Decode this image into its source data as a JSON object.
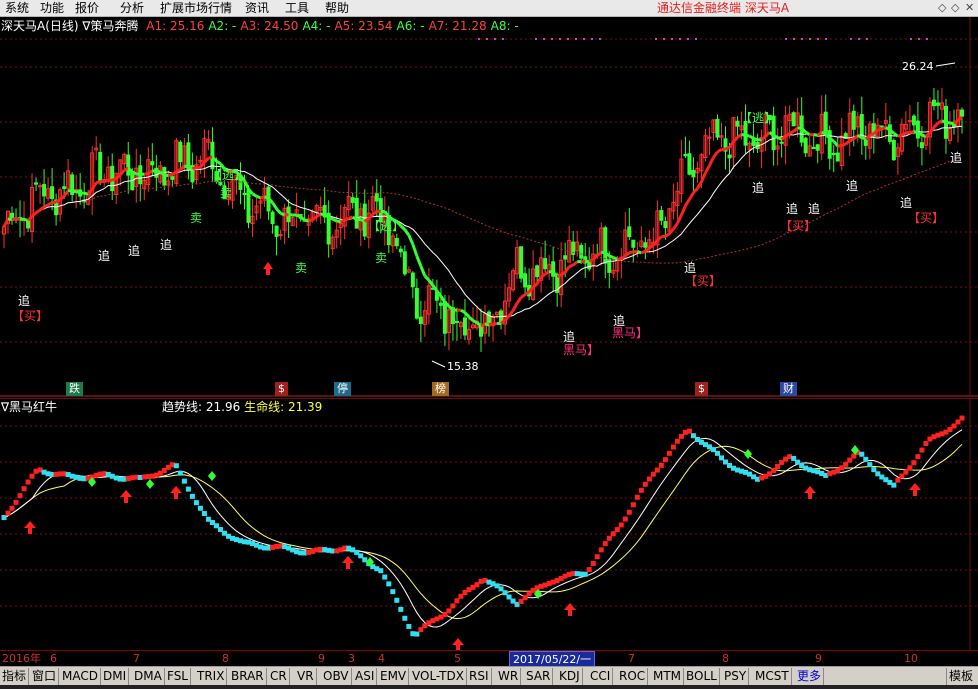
{
  "menu": [
    "系统",
    "功能",
    "报价",
    "分析",
    "扩展市场行情",
    "资讯",
    "工具",
    "帮助"
  ],
  "app_title": "通达信金融终端  深天马A",
  "window_controls": [
    "◇",
    "◇",
    "✕"
  ],
  "main_header": {
    "stock": "深天马A",
    "period": "(日线)",
    "indicator": "∇策马奔腾",
    "values": [
      {
        "label": "A1:",
        "value": "25.16",
        "color": "#ff4040"
      },
      {
        "label": "A2:",
        "value": "-",
        "color": "#40ff40"
      },
      {
        "label": "A3:",
        "value": "24.50",
        "color": "#ff4040"
      },
      {
        "label": "A4:",
        "value": "-",
        "color": "#40ff40"
      },
      {
        "label": "A5:",
        "value": "23.54",
        "color": "#ff4040"
      },
      {
        "label": "A6:",
        "value": "-",
        "color": "#40ff40"
      },
      {
        "label": "A7:",
        "value": "21.28",
        "color": "#ff4040"
      },
      {
        "label": "A8:",
        "value": "-",
        "color": "#40ff40"
      }
    ]
  },
  "indicator_header": {
    "name": "∇黑马红牛",
    "trend_label": "趋势线:",
    "trend_value": "21.96",
    "life_label": "生命线:",
    "life_value": "21.39"
  },
  "price_annotations": {
    "high": "26.24",
    "low": "15.38"
  },
  "signals": [
    {
      "text": "追",
      "color": "#ffffff"
    },
    {
      "text": "【买】",
      "color": "#ff3030"
    },
    {
      "text": "追",
      "color": "#ffffff"
    },
    {
      "text": "追",
      "color": "#ffffff"
    },
    {
      "text": "追",
      "color": "#ffffff"
    },
    {
      "text": "【逃】",
      "color": "#40ff40"
    },
    {
      "text": "卖",
      "color": "#40ff40"
    },
    {
      "text": "卖",
      "color": "#40ff40"
    },
    {
      "text": "卖",
      "color": "#40ff40"
    },
    {
      "text": "【逃】",
      "color": "#40ff40"
    },
    {
      "text": "卖",
      "color": "#40ff40"
    },
    {
      "text": "追",
      "color": "#ffffff"
    },
    {
      "text": "黑马】",
      "color": "#ff3080"
    },
    {
      "text": "追",
      "color": "#ffffff"
    },
    {
      "text": "黑马】",
      "color": "#ff3080"
    },
    {
      "text": "追",
      "color": "#ffffff"
    },
    {
      "text": "【买】",
      "color": "#ff3030"
    },
    {
      "text": "【逃】",
      "color": "#40ff40"
    },
    {
      "text": "追",
      "color": "#ffffff"
    },
    {
      "text": "追",
      "color": "#ffffff"
    },
    {
      "text": "追",
      "color": "#ffffff"
    },
    {
      "text": "【买】",
      "color": "#ff3030"
    },
    {
      "text": "追",
      "color": "#ffffff"
    },
    {
      "text": "追",
      "color": "#ffffff"
    },
    {
      "text": "【买】",
      "color": "#ff3030"
    },
    {
      "text": "追",
      "color": "#ffffff"
    }
  ],
  "event_badges": [
    {
      "text": "跌",
      "color": "#1f7a4a"
    },
    {
      "text": "$",
      "color": "#a02020"
    },
    {
      "text": "停",
      "color": "#1f6a8a"
    },
    {
      "text": "榜",
      "color": "#a06a20"
    },
    {
      "text": "$",
      "color": "#a02020"
    },
    {
      "text": "财",
      "color": "#2a4aa0"
    }
  ],
  "date_axis": {
    "ticks": [
      "2016年",
      "6",
      "7",
      "8",
      "9",
      "3",
      "4",
      "5",
      "7",
      "8",
      "9",
      "10"
    ],
    "cursor_date": "2017/05/22/一"
  },
  "tabs": [
    "指标",
    "窗口",
    "MACD",
    "DMI",
    "DMA",
    "FSL",
    "TRIX",
    "BRAR",
    "CR",
    "VR",
    "OBV",
    "ASI",
    "EMV",
    "VOL-TDX",
    "RSI",
    "WR",
    "SAR",
    "KDJ",
    "CCI",
    "ROC",
    "MTM",
    "BOLL",
    "PSY",
    "MCST",
    "更多",
    "模板"
  ],
  "chart_data": [
    {
      "type": "candlestick",
      "title": "深天马A (日线)",
      "y_range": [
        14,
        28
      ],
      "highest_price": 26.24,
      "lowest_price": 15.38,
      "moving_averages": {
        "A1": 25.16,
        "A3": 24.5,
        "A5": 23.54,
        "A7": 21.28
      },
      "trend_path": [
        20.2,
        21.5,
        21.8,
        22.5,
        22.4,
        22.7,
        23.1,
        21.2,
        20.6,
        20.2,
        20.7,
        20.9,
        17.3,
        16.6,
        16.0,
        18.5,
        18.6,
        19.0,
        19.4,
        19.6,
        22.4,
        23.9,
        23.6,
        24.4,
        23.6,
        24.2,
        24.0,
        24.7,
        24.9
      ],
      "up_color": "#ff3030",
      "down_color": "#30ff30"
    },
    {
      "type": "line",
      "title": "黑马红牛",
      "series": [
        {
          "name": "趋势线",
          "last_value": 21.96,
          "color": "#ffffff"
        },
        {
          "name": "生命线",
          "last_value": 21.39,
          "color": "#ffff60"
        }
      ],
      "grid": true
    }
  ]
}
